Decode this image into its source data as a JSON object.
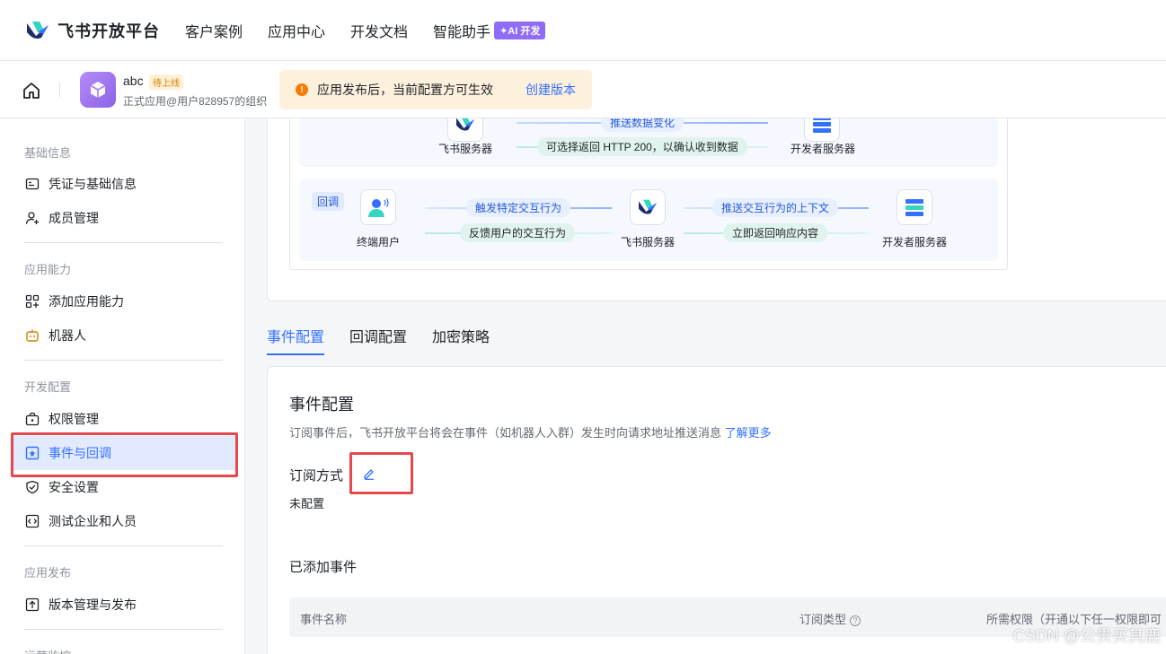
{
  "topnav": {
    "brand": "飞书开放平台",
    "items": [
      "客户案例",
      "应用中心",
      "开发文档",
      "智能助手"
    ],
    "ai_badge": "✦AI 开发"
  },
  "appbar": {
    "app_name": "abc",
    "app_status": "待上线",
    "app_org": "正式应用@用户828957的组织",
    "notice_text": "应用发布后，当前配置方可生效",
    "notice_link": "创建版本"
  },
  "sidebar": {
    "sections": [
      {
        "title": "基础信息",
        "items": [
          "凭证与基础信息",
          "成员管理"
        ]
      },
      {
        "title": "应用能力",
        "items": [
          "添加应用能力",
          "机器人"
        ]
      },
      {
        "title": "开发配置",
        "items": [
          "权限管理",
          "事件与回调",
          "安全设置",
          "测试企业和人员"
        ]
      },
      {
        "title": "应用发布",
        "items": [
          "版本管理与发布"
        ]
      },
      {
        "title": "运营监控",
        "items": []
      }
    ],
    "active_item": "事件与回调"
  },
  "diagram": {
    "event_row": {
      "server_label": "飞书服务器",
      "dev_label": "开发者服务器",
      "push": "推送数据变化",
      "return": "可选择返回 HTTP 200，以确认收到数据"
    },
    "callback_row": {
      "tag": "回调",
      "user_label": "终端用户",
      "server_label": "飞书服务器",
      "dev_label": "开发者服务器",
      "trigger": "触发特定交互行为",
      "feedback": "反馈用户的交互行为",
      "push_ctx": "推送交互行为的上下文",
      "respond": "立即返回响应内容"
    }
  },
  "tabs": [
    "事件配置",
    "回调配置",
    "加密策略"
  ],
  "config": {
    "title": "事件配置",
    "desc": "订阅事件后，飞书开放平台将会在事件（如机器人入群）发生时向请求地址推送消息",
    "learn_more": "了解更多",
    "sub_label": "订阅方式",
    "unset": "未配置",
    "added_title": "已添加事件",
    "table_headers": [
      "事件名称",
      "订阅类型",
      "所需权限（开通以下任一权限即可"
    ]
  },
  "watermark": "CSDN @公贵买其鹿",
  "colors": {
    "accent": "#3370ff",
    "highlight": "#e5484d"
  }
}
